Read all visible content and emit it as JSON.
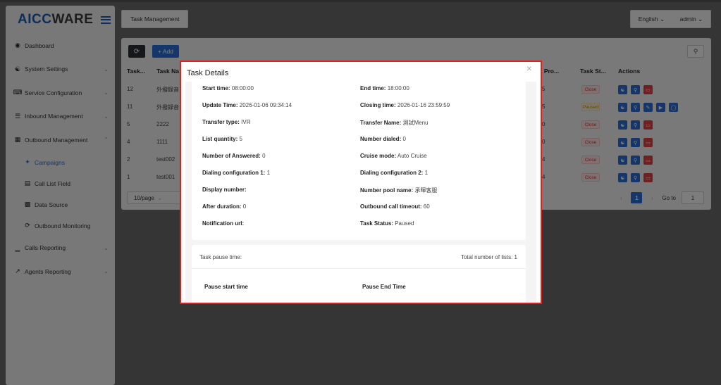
{
  "sidebar": {
    "logo_prefix": "AICC",
    "logo_suffix": "WARE",
    "items": [
      {
        "label": "Dashboard",
        "icon": "dashboard-icon"
      },
      {
        "label": "System Settings",
        "icon": "users-icon"
      },
      {
        "label": "Service Configuration",
        "icon": "keyboard-icon"
      },
      {
        "label": "Inbound Management",
        "icon": "list-icon"
      },
      {
        "label": "Outbound Management",
        "icon": "table-icon"
      },
      {
        "label": "Campaigns",
        "icon": "campaign-icon"
      },
      {
        "label": "Call List Field",
        "icon": "form-icon"
      },
      {
        "label": "Data Source",
        "icon": "grid-icon"
      },
      {
        "label": "Outbound Monitoring",
        "icon": "sync-icon"
      },
      {
        "label": "Calls Reporting",
        "icon": "bar-chart-icon"
      },
      {
        "label": "Agents Reporting",
        "icon": "line-chart-icon"
      }
    ]
  },
  "topbar": {
    "breadcrumb_tag": "Task Management",
    "language": "English",
    "user": "admin"
  },
  "toolbar": {
    "refresh_icon": "refresh-icon",
    "add_label": "+ Add",
    "search_icon": "search-icon"
  },
  "table": {
    "headers": {
      "task_id": "Task...",
      "task_name": "Task Na",
      "task_progress": "sk Pro...",
      "task_status": "Task St...",
      "actions": "Actions"
    },
    "rows": [
      {
        "id": "12",
        "name": "外撥錄音",
        "progress": "5",
        "status": "Close"
      },
      {
        "id": "11",
        "name": "外撥錄音",
        "progress": "5",
        "status": "Paused"
      },
      {
        "id": "5",
        "name": "2222",
        "progress": "0",
        "status": "Close"
      },
      {
        "id": "4",
        "name": "1111",
        "progress": "0",
        "status": "Close"
      },
      {
        "id": "2",
        "name": "test002",
        "progress": "4",
        "status": "Close"
      },
      {
        "id": "1",
        "name": "test001",
        "progress": "4",
        "status": "Close"
      }
    ]
  },
  "pagination": {
    "page_size": "10/page",
    "current_page": "1",
    "goto_label": "Go to",
    "goto_value": "1"
  },
  "colors": {
    "brand_blue": "#2a6cd6",
    "status_close": "#d33333",
    "status_paused": "#c78a0a",
    "modal_highlight": "#e0201a"
  },
  "modal": {
    "title": "Task Details",
    "details": {
      "start_time_label": "Start time",
      "start_time_value": "08:00:00",
      "end_time_label": "End time",
      "end_time_value": "18:00:00",
      "update_time_label": "Update Time",
      "update_time_value": "2026-01-06 09:34:14",
      "closing_time_label": "Closing time",
      "closing_time_value": "2026-01-16 23:59:59",
      "transfer_type_label": "Transfer type",
      "transfer_type_value": "IVR",
      "transfer_name_label": "Transfer Name",
      "transfer_name_value": "測試Menu",
      "list_quantity_label": "List quantity",
      "list_quantity_value": "5",
      "number_dialed_label": "Number dialed",
      "number_dialed_value": "0",
      "answered_label": "Number of Answered",
      "answered_value": "0",
      "cruise_mode_label": "Cruise mode",
      "cruise_mode_value": "Auto Cruise",
      "dialing_cfg1_label": "Dialing configuration 1",
      "dialing_cfg1_value": "1",
      "dialing_cfg2_label": "Dialing configuration 2",
      "dialing_cfg2_value": "1",
      "display_number_label": "Display number",
      "display_number_value": "",
      "number_pool_label": "Number pool name",
      "number_pool_value": "承暉客服",
      "after_duration_label": "After duration",
      "after_duration_value": "0",
      "outbound_timeout_label": "Outbound call timeout",
      "outbound_timeout_value": "60",
      "notification_url_label": "Notification url",
      "notification_url_value": "",
      "task_status_label": "Task Status",
      "task_status_value": "Paused"
    },
    "pause": {
      "pause_time_label": "Task pause time:",
      "total_lists_label": "Total number of lists",
      "total_lists_value": "1",
      "col_start": "Pause start time",
      "col_end": "Pause End Time"
    }
  }
}
